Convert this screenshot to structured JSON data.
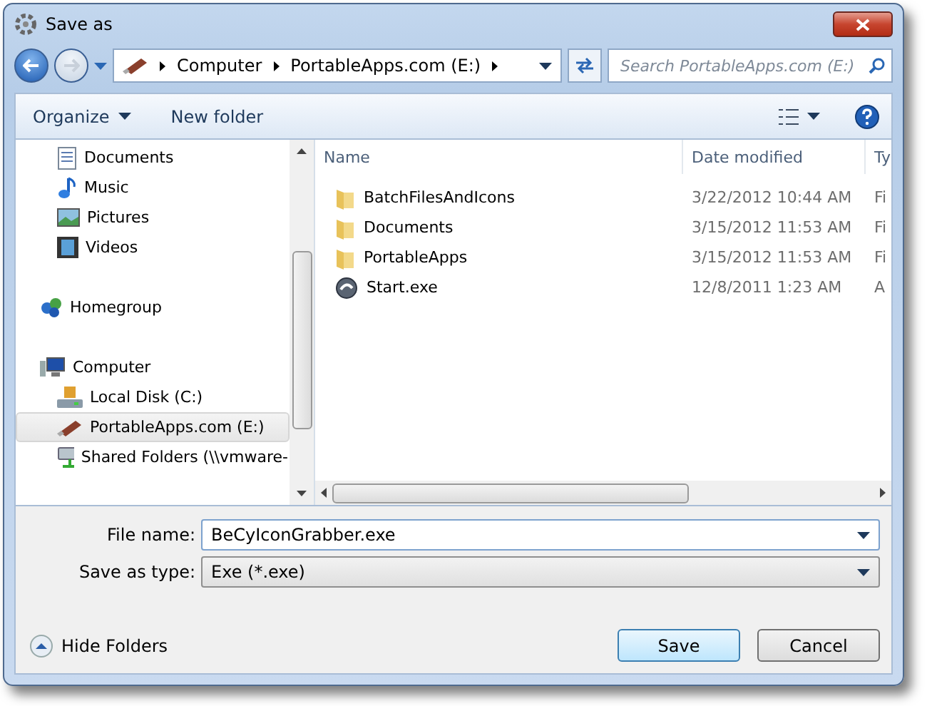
{
  "window": {
    "title": "Save as"
  },
  "address": {
    "crumbs": [
      "Computer",
      "PortableApps.com (E:)"
    ]
  },
  "search": {
    "placeholder": "Search PortableApps.com (E:)"
  },
  "toolbar": {
    "organize": "Organize",
    "new_folder": "New folder"
  },
  "sidebar": {
    "groups": [
      {
        "items": [
          {
            "label": "Documents",
            "kind": "documents",
            "indent": true,
            "selected": false
          },
          {
            "label": "Music",
            "kind": "music",
            "indent": true,
            "selected": false
          },
          {
            "label": "Pictures",
            "kind": "pictures",
            "indent": true,
            "selected": false
          },
          {
            "label": "Videos",
            "kind": "videos",
            "indent": true,
            "selected": false
          }
        ]
      },
      {
        "items": [
          {
            "label": "Homegroup",
            "kind": "homegroup",
            "indent": false,
            "selected": false
          }
        ]
      },
      {
        "items": [
          {
            "label": "Computer",
            "kind": "computer",
            "indent": false,
            "selected": false
          },
          {
            "label": "Local Disk (C:)",
            "kind": "disk",
            "indent": true,
            "selected": false
          },
          {
            "label": "PortableApps.com (E:)",
            "kind": "usb",
            "indent": true,
            "selected": true
          },
          {
            "label": "Shared Folders (\\\\vmware-",
            "kind": "network",
            "indent": true,
            "selected": false
          }
        ]
      }
    ]
  },
  "table": {
    "columns": [
      "Name",
      "Date modified",
      "Ty"
    ],
    "rows": [
      {
        "name": "BatchFilesAndIcons",
        "date": "3/22/2012 10:44 AM",
        "type": "Fi",
        "kind": "folder"
      },
      {
        "name": "Documents",
        "date": "3/15/2012 11:53 AM",
        "type": "Fi",
        "kind": "folder"
      },
      {
        "name": "PortableApps",
        "date": "3/15/2012 11:53 AM",
        "type": "Fi",
        "kind": "folder"
      },
      {
        "name": "Start.exe",
        "date": "12/8/2011 1:23 AM",
        "type": "A",
        "kind": "exe"
      }
    ]
  },
  "form": {
    "file_name_label": "File name:",
    "file_name": "BeCyIconGrabber.exe",
    "type_label": "Save as type:",
    "type": "Exe (*.exe)"
  },
  "hide_folders": "Hide Folders",
  "buttons": {
    "save": "Save",
    "cancel": "Cancel"
  }
}
